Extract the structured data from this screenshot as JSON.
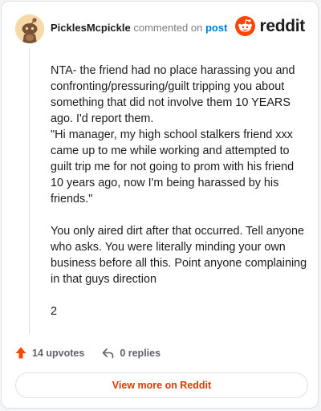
{
  "header": {
    "username": "PicklesMcpickle",
    "action_text": "commented on",
    "post_link": "post",
    "brand_name": "reddit"
  },
  "comment": {
    "paragraphs": [
      "NTA- the friend had no place harassing you and confronting/pressuring/guilt tripping you about something that did not involve them 10 YEARS ago. I'd report them.\n\"Hi manager, my high school stalkers friend xxx came up to me while working and attempted to guilt trip me for not going to prom with his friend 10 years ago, now I'm being harassed by his friends.\"",
      "You only aired dirt after that occurred. Tell anyone who asks. You were literally minding your own business before all this. Point anyone complaining in that guys direction",
      "2"
    ]
  },
  "footer": {
    "upvotes": "14 upvotes",
    "replies": "0 replies",
    "view_button": "View more on Reddit"
  },
  "colors": {
    "brand_orange": "#ff4500",
    "link_blue": "#0079d3",
    "button_text": "#d93a00"
  },
  "icons": {
    "avatar": "snoo-avatar",
    "brand": "reddit-logo-icon",
    "upvote": "upvote-arrow-icon",
    "reply": "reply-arrow-icon"
  }
}
